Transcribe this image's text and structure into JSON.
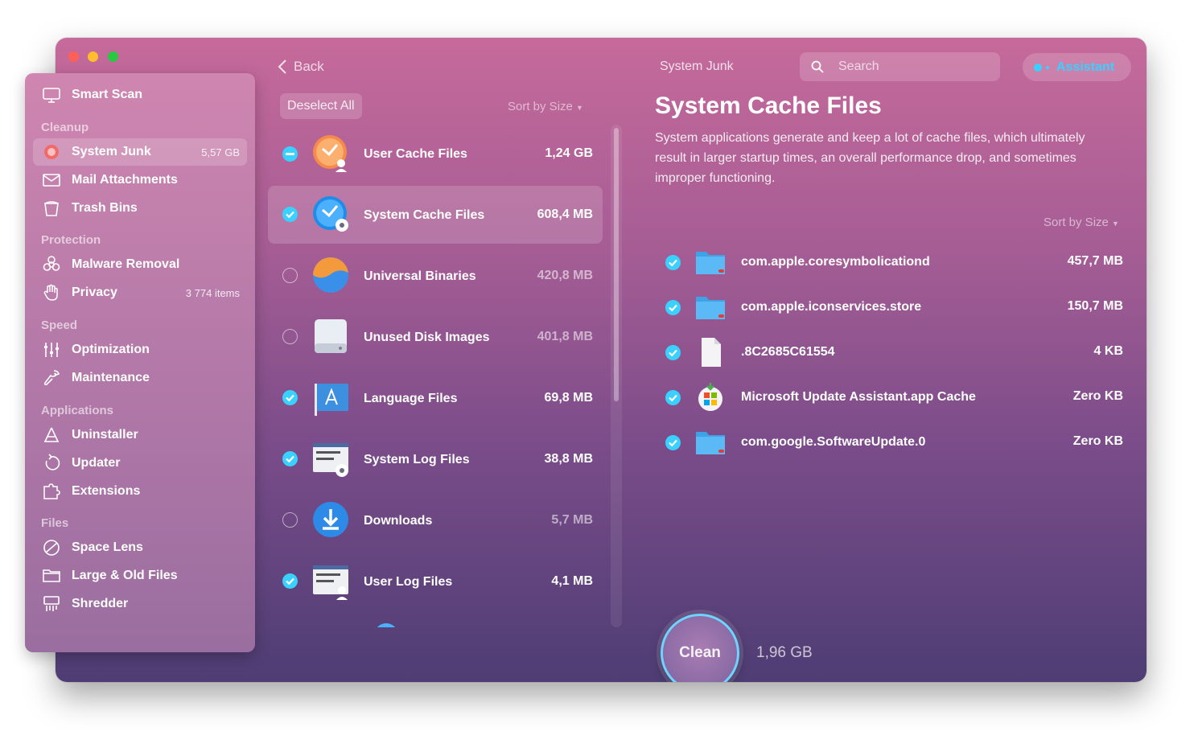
{
  "colors": {
    "accent": "#3ad0ff",
    "close": "#fe5f57",
    "minimize": "#febc2e",
    "zoom": "#28c840"
  },
  "sidebar": {
    "smart_scan": "Smart Scan",
    "sections": {
      "cleanup": "Cleanup",
      "protection": "Protection",
      "speed": "Speed",
      "applications": "Applications",
      "files": "Files"
    },
    "items": {
      "system_junk": {
        "label": "System Junk",
        "badge": "5,57 GB"
      },
      "mail_attachments": "Mail Attachments",
      "trash_bins": "Trash Bins",
      "malware_removal": "Malware Removal",
      "privacy": {
        "label": "Privacy",
        "badge": "3 774 items"
      },
      "optimization": "Optimization",
      "maintenance": "Maintenance",
      "uninstaller": "Uninstaller",
      "updater": "Updater",
      "extensions": "Extensions",
      "space_lens": "Space Lens",
      "large_old_files": "Large & Old Files",
      "shredder": "Shredder"
    }
  },
  "topbar": {
    "back": "Back",
    "title": "System Junk",
    "search_placeholder": "Search",
    "assistant": "Assistant"
  },
  "list": {
    "deselect_all": "Deselect All",
    "sort": "Sort by Size",
    "rows": [
      {
        "label": "User Cache Files",
        "size": "1,24 GB",
        "state": "mixed",
        "icon": "user-cache-icon"
      },
      {
        "label": "System Cache Files",
        "size": "608,4 MB",
        "state": "checked",
        "icon": "system-cache-icon"
      },
      {
        "label": "Universal Binaries",
        "size": "420,8 MB",
        "state": "unchecked",
        "icon": "universal-binaries-icon"
      },
      {
        "label": "Unused Disk Images",
        "size": "401,8 MB",
        "state": "unchecked",
        "icon": "disk-image-icon"
      },
      {
        "label": "Language Files",
        "size": "69,8 MB",
        "state": "checked",
        "icon": "language-files-icon"
      },
      {
        "label": "System Log Files",
        "size": "38,8 MB",
        "state": "checked",
        "icon": "system-log-icon"
      },
      {
        "label": "Downloads",
        "size": "5,7 MB",
        "state": "unchecked",
        "icon": "downloads-icon"
      },
      {
        "label": "User Log Files",
        "size": "4,1 MB",
        "state": "checked",
        "icon": "user-log-icon"
      }
    ]
  },
  "detail": {
    "title": "System Cache Files",
    "description": "System applications generate and keep a lot of cache files, which ultimately result in larger startup times, an overall performance drop, and sometimes improper functioning.",
    "sort": "Sort by Size",
    "files": [
      {
        "name": "com.apple.coresymbolicationd",
        "size": "457,7 MB",
        "icon": "folder-icon"
      },
      {
        "name": "com.apple.iconservices.store",
        "size": "150,7 MB",
        "icon": "folder-icon"
      },
      {
        "name": ".8C2685C61554",
        "size": "4 KB",
        "icon": "document-icon"
      },
      {
        "name": "Microsoft Update Assistant.app Cache",
        "size": "Zero KB",
        "icon": "microsoft-update-icon"
      },
      {
        "name": "com.google.SoftwareUpdate.0",
        "size": "Zero KB",
        "icon": "folder-icon"
      }
    ]
  },
  "footer": {
    "clean": "Clean",
    "total": "1,96 GB"
  }
}
